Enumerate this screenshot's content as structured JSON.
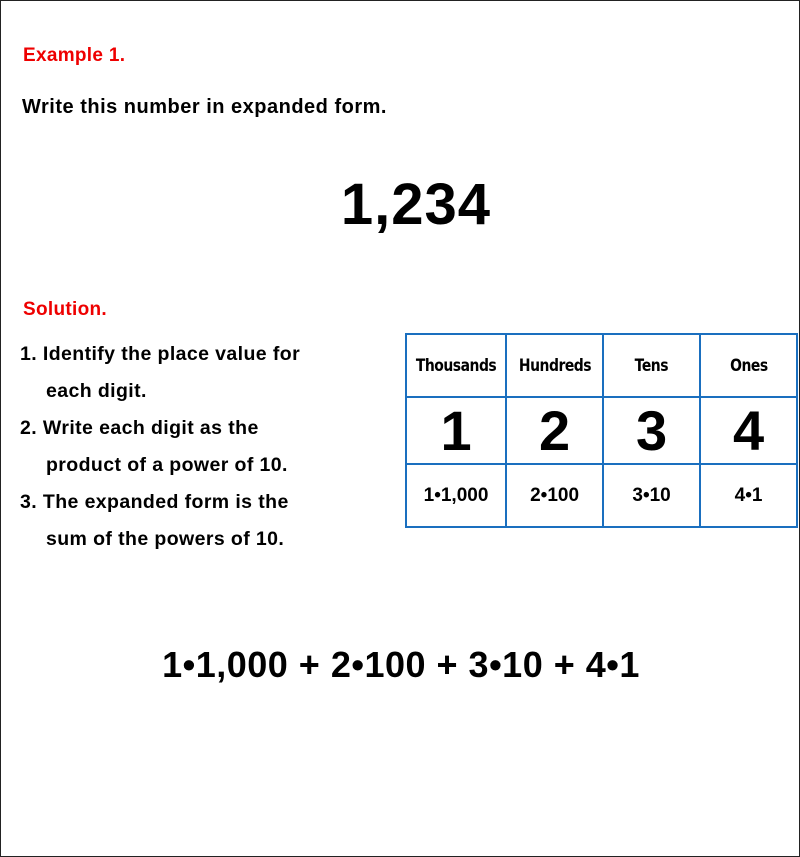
{
  "example": {
    "header": "Example 1.",
    "prompt": "Write this number in expanded form.",
    "number": "1,234"
  },
  "solution": {
    "header": "Solution.",
    "steps": [
      {
        "line1": "1. Identify the place value for",
        "line2": "each digit."
      },
      {
        "line1": "2. Write each digit as the",
        "line2": "product of a power of 10."
      },
      {
        "line1": "3. The expanded form is the",
        "line2": "sum of the powers of 10."
      }
    ]
  },
  "place_value_table": {
    "headers": [
      "Thousands",
      "Hundreds",
      "Tens",
      "Ones"
    ],
    "digits": [
      "1",
      "2",
      "3",
      "4"
    ],
    "products": [
      "1•1,000",
      "2•100",
      "3•10",
      "4•1"
    ]
  },
  "answer": "1•1,000 + 2•100 + 3•10 + 4•1",
  "colors": {
    "heading_red": "#ee0000",
    "table_border_blue": "#1a6fbf",
    "text": "#000000"
  }
}
